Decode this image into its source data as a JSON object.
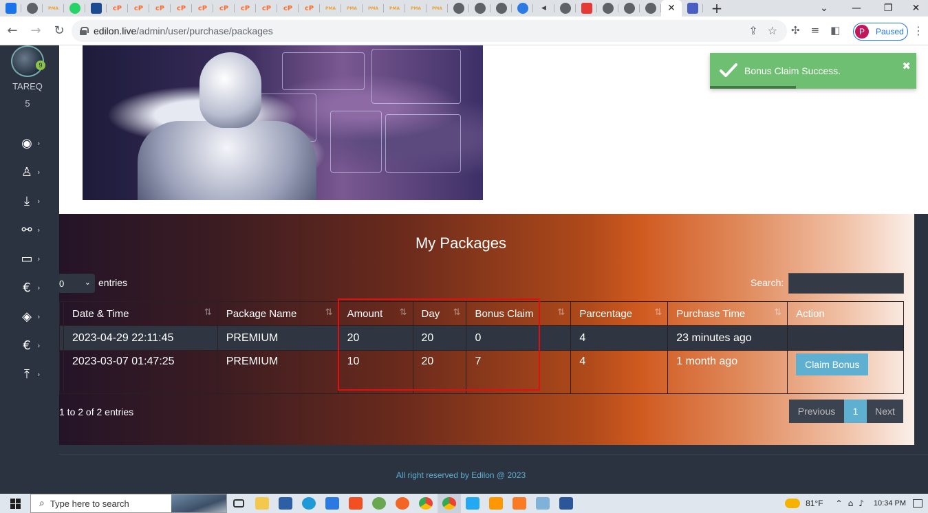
{
  "browser": {
    "address_host": "edilon.live",
    "address_path": "/admin/user/purchase/packages",
    "profile_initial": "P",
    "profile_status": "Paused",
    "tab_favicons": [
      {
        "icon": "app-icon",
        "color": "#1a73e8",
        "text": ""
      },
      {
        "icon": "chrome-gray-icon",
        "color": "#5f6368",
        "text": ""
      },
      {
        "icon": "pma-icon",
        "color": "#e8a33d",
        "text": "PMA"
      },
      {
        "icon": "whatsapp-icon",
        "color": "#25d366",
        "text": ""
      },
      {
        "icon": "shield-icon",
        "color": "#1e4b8f",
        "text": ""
      },
      {
        "icon": "cpanel-icon",
        "color": "#ff6c2c",
        "text": "cP"
      },
      {
        "icon": "cpanel-icon",
        "color": "#ff6c2c",
        "text": "cP"
      },
      {
        "icon": "cpanel-icon",
        "color": "#ff6c2c",
        "text": "cP"
      },
      {
        "icon": "cpanel-icon",
        "color": "#ff6c2c",
        "text": "cP"
      },
      {
        "icon": "cpanel-icon",
        "color": "#ff6c2c",
        "text": "cP"
      },
      {
        "icon": "cpanel-icon",
        "color": "#ff6c2c",
        "text": "cP"
      },
      {
        "icon": "cpanel-icon",
        "color": "#ff6c2c",
        "text": "cP"
      },
      {
        "icon": "cpanel-icon",
        "color": "#ff6c2c",
        "text": "cP"
      },
      {
        "icon": "cpanel-icon",
        "color": "#ff6c2c",
        "text": "cP"
      },
      {
        "icon": "cpanel-icon",
        "color": "#ff6c2c",
        "text": "cP"
      },
      {
        "icon": "pma-icon",
        "color": "#e8a33d",
        "text": "PMA"
      },
      {
        "icon": "pma-icon",
        "color": "#e8a33d",
        "text": "PMA"
      },
      {
        "icon": "pma-icon",
        "color": "#e8a33d",
        "text": "PMA"
      },
      {
        "icon": "pma-icon",
        "color": "#e8a33d",
        "text": "PMA"
      },
      {
        "icon": "pma-icon",
        "color": "#e8a33d",
        "text": "PMA"
      },
      {
        "icon": "pma-icon",
        "color": "#e8a33d",
        "text": "PMA"
      },
      {
        "icon": "chrome-gray-icon",
        "color": "#5f6368",
        "text": ""
      },
      {
        "icon": "chrome-gray-icon",
        "color": "#5f6368",
        "text": ""
      },
      {
        "icon": "chrome-gray-icon",
        "color": "#5f6368",
        "text": ""
      },
      {
        "icon": "circle-blue-icon",
        "color": "#2a7ae2",
        "text": ""
      },
      {
        "icon": "speaker-icon",
        "color": "#444",
        "text": ""
      },
      {
        "icon": "chrome-gray-icon",
        "color": "#5f6368",
        "text": ""
      },
      {
        "icon": "map-pin-icon",
        "color": "#e53935",
        "text": ""
      },
      {
        "icon": "chrome-gray-icon",
        "color": "#5f6368",
        "text": ""
      },
      {
        "icon": "chrome-gray-icon",
        "color": "#5f6368",
        "text": ""
      },
      {
        "icon": "chrome-gray-icon",
        "color": "#5f6368",
        "text": ""
      }
    ]
  },
  "sidebar": {
    "username": "TAREQ",
    "level": "5",
    "badge": "9",
    "items": [
      {
        "icon": "dashboard-icon",
        "glyph": "◉"
      },
      {
        "icon": "user-icon",
        "glyph": "♙"
      },
      {
        "icon": "download-icon",
        "glyph": "⤓"
      },
      {
        "icon": "link-icon",
        "glyph": "⚯"
      },
      {
        "icon": "window-icon",
        "glyph": "▭"
      },
      {
        "icon": "euro-icon",
        "glyph": "€"
      },
      {
        "icon": "ticket-icon",
        "glyph": "◈"
      },
      {
        "icon": "euro-icon",
        "glyph": "€"
      },
      {
        "icon": "upload-icon",
        "glyph": "⤒"
      }
    ]
  },
  "toast": {
    "message": "Bonus Claim Success.",
    "color": "#6fbf73"
  },
  "packages": {
    "title": "My Packages",
    "entries_value": "0",
    "entries_label": "entries",
    "search_label": "Search:",
    "columns": [
      "Date & Time",
      "Package Name",
      "Amount",
      "Day",
      "Bonus Claim",
      "Parcentage",
      "Purchase Time",
      "Action"
    ],
    "rows": [
      {
        "date": "2023-04-29 22:11:45",
        "package": "PREMIUM",
        "amount": "20",
        "day": "20",
        "bonus_claim": "0",
        "percentage": "4",
        "purchase_time": "23 minutes ago",
        "action": ""
      },
      {
        "date": "2023-03-07 01:47:25",
        "package": "PREMIUM",
        "amount": "10",
        "day": "20",
        "bonus_claim": "7",
        "percentage": "4",
        "purchase_time": "1 month ago",
        "action": "Claim Bonus"
      }
    ],
    "info": "1 to 2 of 2 entries",
    "pager": {
      "previous": "Previous",
      "current": "1",
      "next": "Next"
    }
  },
  "footer": {
    "text": "All right reserved by Edilon @ 2023"
  },
  "taskbar": {
    "search_placeholder": "Type here to search",
    "temperature": "81°F",
    "time": "10:34 PM"
  }
}
